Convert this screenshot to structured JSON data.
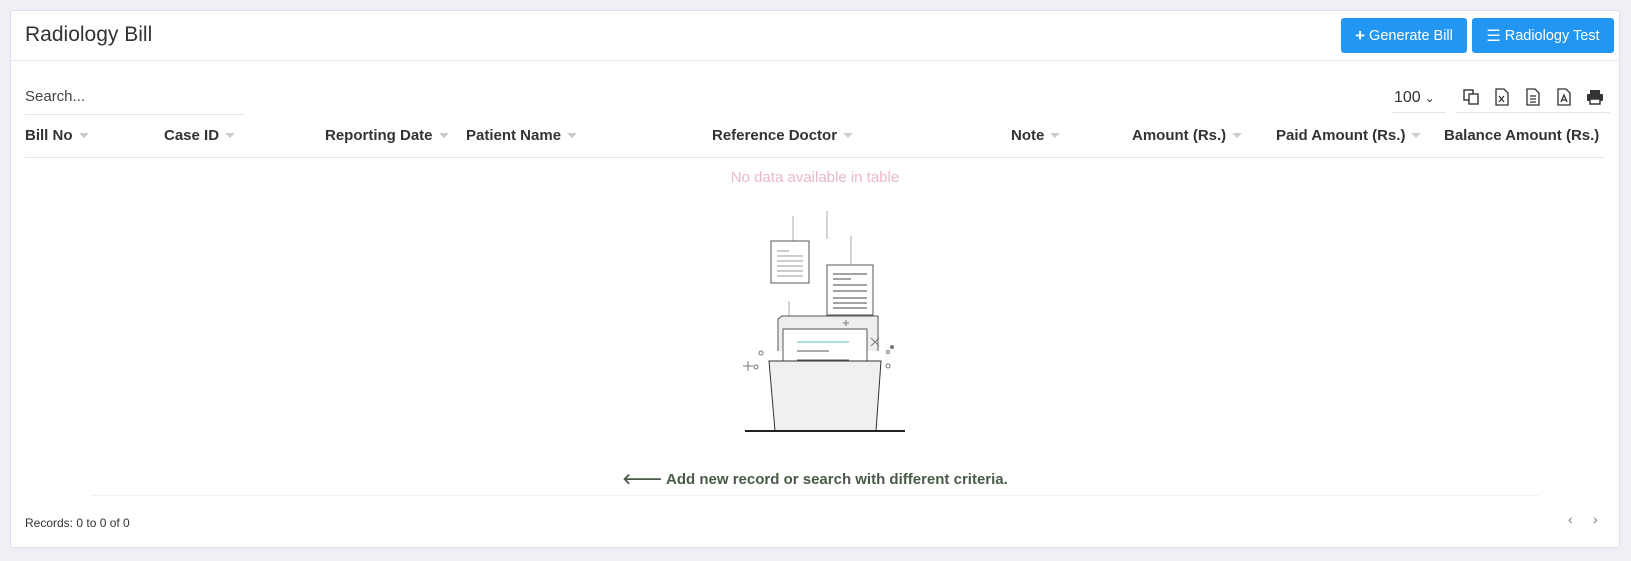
{
  "header": {
    "title": "Radiology Bill",
    "generate_bill": "Generate Bill",
    "radiology_test": "Radiology Test"
  },
  "toolbar": {
    "search_placeholder": "Search...",
    "page_length": "100",
    "export_icons": [
      "copy-icon",
      "excel-icon",
      "csv-icon",
      "pdf-icon",
      "print-icon"
    ]
  },
  "table": {
    "columns": [
      "Bill No",
      "Case ID",
      "Reporting Date",
      "Patient Name",
      "Reference Doctor",
      "Note",
      "Amount (Rs.)",
      "Paid Amount (Rs.)",
      "Balance Amount (Rs.)"
    ],
    "empty_text": "No data available in table",
    "empty_hint": "Add new record or search with different criteria."
  },
  "footer": {
    "records": "Records: 0 to 0 of 0",
    "prev": "‹",
    "next": "›"
  },
  "colors": {
    "accent": "#2196f3"
  }
}
